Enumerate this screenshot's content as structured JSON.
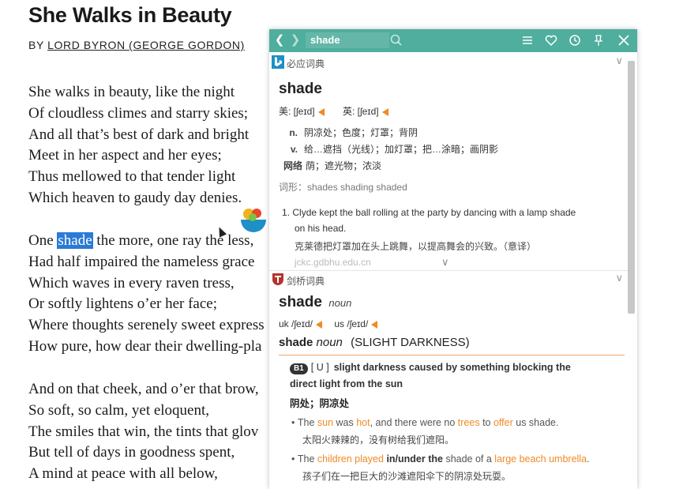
{
  "poem": {
    "title": "She Walks in Beauty",
    "by_prefix": "BY ",
    "author": "LORD BYRON (GEORGE GORDON)",
    "stanza1": [
      "She walks in beauty, like the night",
      "Of cloudless climes and starry skies;",
      "And all that’s best of dark and bright",
      "Meet in her aspect and her eyes;",
      "Thus mellowed to that tender light",
      "Which heaven to gaudy day denies."
    ],
    "stanza2_first_pre": "One ",
    "stanza2_first_hl": "shade",
    "stanza2_first_post": " the more, one ray the less,",
    "stanza2": [
      "Had half impaired the nameless grace",
      "Which waves in every raven tress,",
      "Or softly lightens o’er her face;",
      "Where thoughts serenely sweet express",
      "How pure, how dear their dwelling-pla"
    ],
    "stanza3": [
      "And on that cheek, and o’er that brow,",
      "So soft, so calm, yet eloquent,",
      "The smiles that win, the tints that glov",
      "But tell of days in goodness spent,",
      "A mind at peace with all below,"
    ]
  },
  "dict": {
    "query": "shade",
    "icons": {
      "back": "back-arrow-icon",
      "forward": "forward-arrow-icon",
      "search": "search-icon",
      "menu": "menu-icon",
      "favorite": "heart-icon",
      "history": "history-icon",
      "pin": "pin-icon",
      "close": "close-icon"
    },
    "bing": {
      "name": "必应词典",
      "word": "shade",
      "us_label": "美: [ʃeɪd]",
      "uk_label": "英: [ʃeɪd]",
      "defs": [
        {
          "pos": "n.",
          "text": "阴凉处；色度；灯罩；背阴"
        },
        {
          "pos": "v.",
          "text": "给…遮挡（光线）；加灯罩；把…涂暗；画阴影"
        },
        {
          "pos": "网络",
          "text": "荫；遮光物；浓淡"
        }
      ],
      "forms": "词形：shades   shading   shaded",
      "example_num": "1.",
      "example_en_1": "Clyde kept the ball rolling at the party by dancing with a lamp shade",
      "example_en_2": "on his head.",
      "example_cn_1": "克莱德把灯罩加在头上跳舞，以提高舞会的兴致。",
      "example_cn_2": "（意译）",
      "source": "jckc.gdbhu.edu.cn"
    },
    "cambridge": {
      "name": "剑桥词典",
      "word": "shade",
      "pos": "noun",
      "uk": "uk",
      "uk_ipa": "/ʃeɪd/",
      "us": "us",
      "us_ipa": "/ʃeɪd/",
      "guide_word": "shade",
      "guide_pos": "noun",
      "guide_meaning": "(SLIGHT DARKNESS)",
      "level": "B1",
      "grammar": "[ U ]",
      "definition_1": "slight darkness caused by something blocking the",
      "definition_2": "direct light from the sun",
      "cn_definition": "阴处；阴凉处",
      "ex1_the": "The ",
      "ex1_sun": "sun",
      "ex1_was": " was ",
      "ex1_hot": "hot",
      "ex1_mid": ", and there were no ",
      "ex1_trees": "trees",
      "ex1_to": " to ",
      "ex1_offer": "offer",
      "ex1_end": " us shade.",
      "ex1_cn": "太阳火辣辣的，没有树给我们遮阳。",
      "ex2_the": "The ",
      "ex2_children_played": "children played",
      "ex2_mid": " in/under the",
      "ex2_mid2": " shade of a ",
      "ex2_umbrella": "large beach umbrella",
      "ex2_end": ".",
      "ex2_cn": "孩子们在一把巨大的沙滩遮阳伞下的阴凉处玩耍。"
    }
  }
}
